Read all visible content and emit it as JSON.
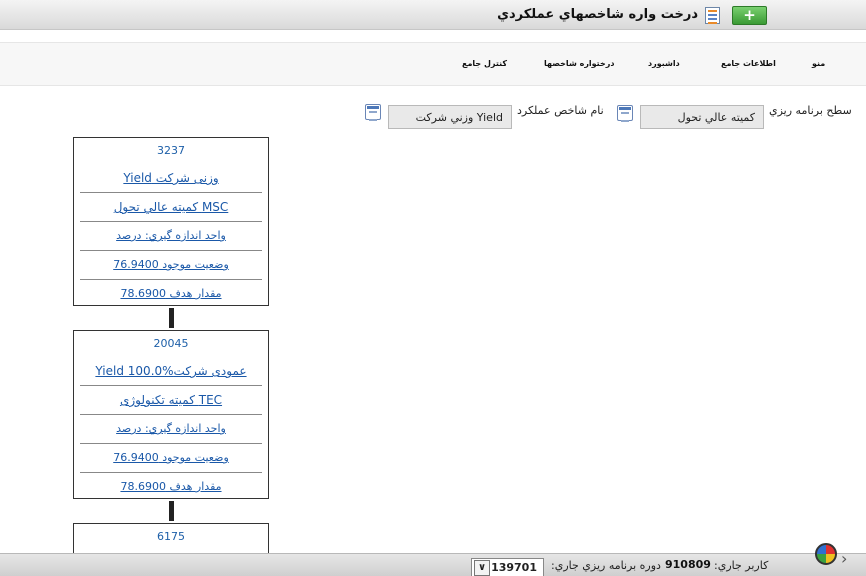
{
  "header": {
    "title": "درخت واره شاخصهاي عملکردي",
    "add_label": "+"
  },
  "nav": {
    "items": [
      "منو",
      "اطلاعات جامع",
      "داشبورد",
      "درختواره شاخصها",
      "كنترل جامع"
    ]
  },
  "filters": {
    "planning_level_label": "سطح برنامه ريزي",
    "planning_level_value": "كميته عالي تحول",
    "kpi_name_label": "نام شاخص عملكرد",
    "kpi_name_value": "Yield وزني شركت"
  },
  "tree": [
    {
      "id": "3237",
      "rows": [
        "وزنی شرکت Yield",
        "MSC  كميته عالي تحول",
        "واحد اندازه گيري: درصد",
        "وضعيت موجود 76.9400",
        "مقدار هدف 78.6900"
      ]
    },
    {
      "id": "20045",
      "rows": [
        "عمودی شرکتYield 100.0%",
        "TEC  كميته تكنولوژی",
        "واحد اندازه گيري: درصد",
        "وضعيت موجود 76.9400",
        "مقدار هدف 78.6900"
      ]
    },
    {
      "id": "6175",
      "rows": []
    }
  ],
  "footer": {
    "current_user_label": "کاربر جاري:",
    "current_user_value": "910809",
    "period_label": "دوره برنامه ريزي جاري:",
    "period_value": "139701"
  }
}
